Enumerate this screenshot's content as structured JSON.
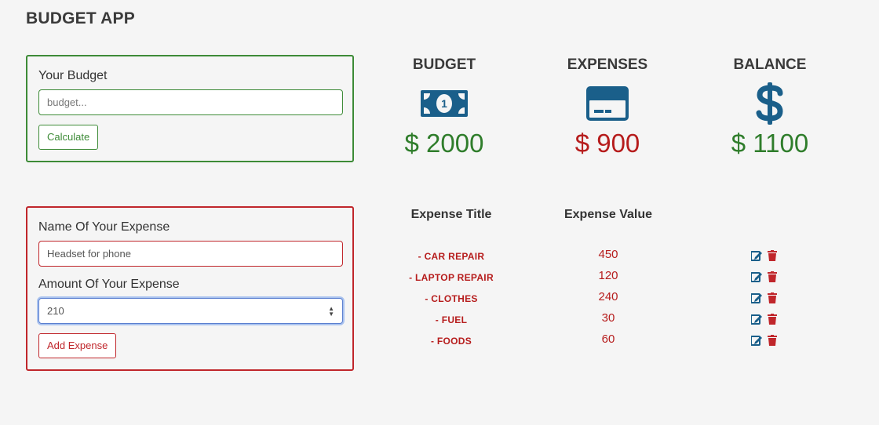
{
  "app": {
    "title": "BUDGET APP"
  },
  "budget_form": {
    "label": "Your Budget",
    "placeholder": "budget...",
    "value": "",
    "button": "Calculate"
  },
  "expense_form": {
    "name_label": "Name Of Your Expense",
    "name_value": "Headset for phone",
    "amount_label": "Amount Of Your Expense",
    "amount_value": "210",
    "button": "Add Expense"
  },
  "summary": {
    "budget": {
      "label": "BUDGET",
      "amount": "$ 2000",
      "icon": "money-bill-icon"
    },
    "expenses": {
      "label": "EXPENSES",
      "amount": "$ 900",
      "icon": "credit-card-icon"
    },
    "balance": {
      "label": "BALANCE",
      "amount": "$ 1100",
      "icon": "dollar-sign-icon"
    }
  },
  "expense_list": {
    "title_header": "Expense Title",
    "value_header": "Expense Value",
    "items": [
      {
        "title": "- CAR REPAIR",
        "value": "450"
      },
      {
        "title": "- LAPTOP REPAIR",
        "value": "120"
      },
      {
        "title": "- CLOTHES",
        "value": "240"
      },
      {
        "title": "- FUEL",
        "value": "30"
      },
      {
        "title": "- FOODS",
        "value": "60"
      }
    ]
  },
  "colors": {
    "success": "#3d8b37",
    "danger": "#c0262b",
    "icon": "#1a5f8a"
  }
}
